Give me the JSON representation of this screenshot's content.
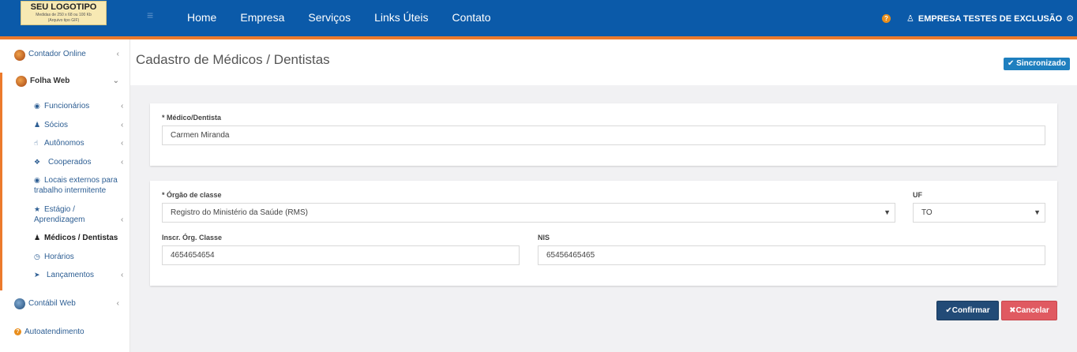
{
  "logo": {
    "line1": "SEU LOGOTIPO",
    "line2": "Medidas de 250 x 68 ou 100 Kb",
    "line3": "(Arquivo tipo GIF)"
  },
  "nav": {
    "items": [
      "Home",
      "Empresa",
      "Serviços",
      "Links Úteis",
      "Contato"
    ]
  },
  "header": {
    "help_icon": "question-icon",
    "company_name": "EMPRESA TESTES DE EXCLUSÃO"
  },
  "sidebar": {
    "contador": "Contador Online",
    "folha": "Folha Web",
    "sub": [
      {
        "label": "Funcionários",
        "icon": "user-circle-icon"
      },
      {
        "label": "Sócios",
        "icon": "user-plus-icon"
      },
      {
        "label": "Autônomos",
        "icon": "thumbs-up-icon"
      },
      {
        "label": "Cooperados",
        "icon": "handshake-icon"
      },
      {
        "label": "Locais externos para trabalho intermitente",
        "icon": "globe-icon"
      },
      {
        "label": "Estágio / Aprendizagem",
        "icon": "star-icon"
      },
      {
        "label": "Médicos / Dentistas",
        "icon": "user-md-icon"
      },
      {
        "label": "Horários",
        "icon": "clock-icon"
      },
      {
        "label": "Lançamentos",
        "icon": "bullhorn-icon"
      }
    ],
    "contabil": "Contábil Web",
    "autoatendimento": "Autoatendimento"
  },
  "page": {
    "title": "Cadastro de Médicos / Dentistas",
    "sync_badge": "Sincronizado"
  },
  "form": {
    "medico_label": "* Médico/Dentista",
    "medico_value": "Carmen Miranda",
    "orgao_label": "* Órgão de classe",
    "orgao_value": "Registro do Ministério da Saúde (RMS)",
    "uf_label": "UF",
    "uf_value": "TO",
    "inscr_label": "Inscr. Órg. Classe",
    "inscr_value": "4654654654",
    "nis_label": "NIS",
    "nis_value": "65456465465"
  },
  "actions": {
    "confirm": "Confirmar",
    "cancel": "Cancelar"
  }
}
